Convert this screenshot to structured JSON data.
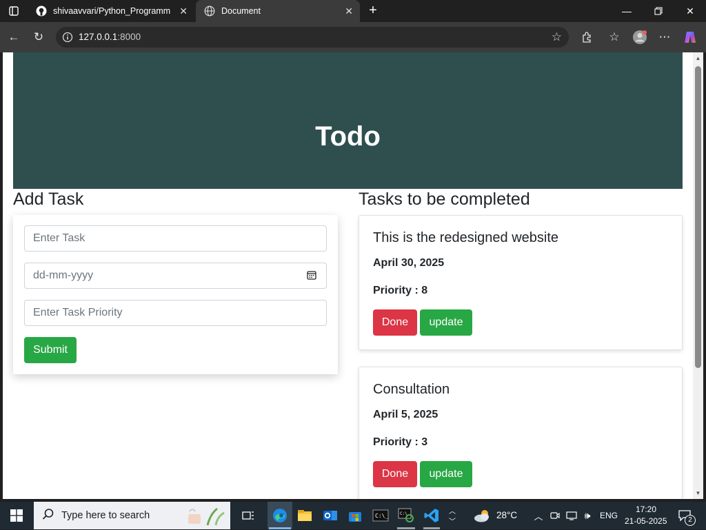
{
  "browser": {
    "tabs": [
      {
        "title": "shivaavvari/Python_Programming",
        "active": false
      },
      {
        "title": "Document",
        "active": true
      }
    ],
    "address": {
      "host": "127.0.0.1",
      "port": ":8000"
    }
  },
  "page": {
    "hero_title": "Todo",
    "add_task": {
      "heading": "Add Task",
      "task_placeholder": "Enter Task",
      "date_placeholder": "dd-mm-yyyy",
      "priority_placeholder": "Enter Task Priority",
      "submit_label": "Submit"
    },
    "tasks_heading": "Tasks to be completed",
    "tasks": [
      {
        "title": "This is the redesigned website",
        "date": "April 30, 2025",
        "priority": "Priority : 8",
        "done_label": "Done",
        "update_label": "update"
      },
      {
        "title": "Consultation",
        "date": "April 5, 2025",
        "priority": "Priority : 3",
        "done_label": "Done",
        "update_label": "update"
      }
    ]
  },
  "taskbar": {
    "search_placeholder": "Type here to search",
    "weather": "28°C",
    "language": "ENG",
    "time": "17:20",
    "date": "21-05-2025",
    "notification_count": "2"
  }
}
